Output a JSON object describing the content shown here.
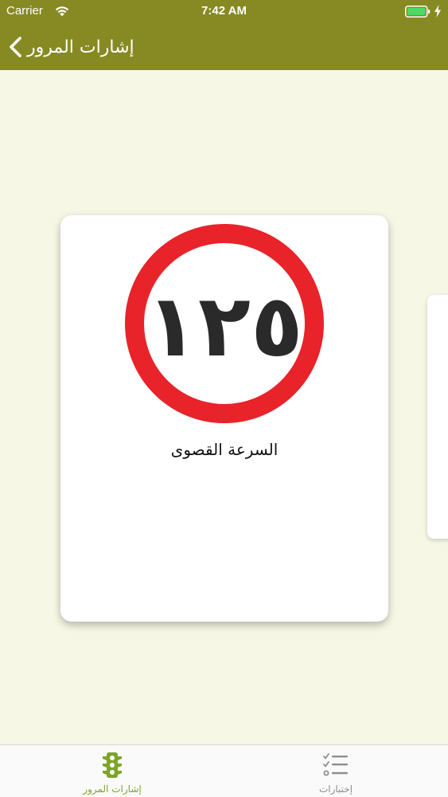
{
  "status_bar": {
    "carrier": "Carrier",
    "time": "7:42 AM"
  },
  "nav": {
    "title": "إشارات المرور",
    "back_icon": "chevron-left-icon"
  },
  "card": {
    "sign_number": "١٢٥",
    "caption": "السرعة القصوى"
  },
  "tabs": [
    {
      "label": "إشارات المرور",
      "icon": "traffic-light-icon",
      "selected": true
    },
    {
      "label": "إختبارات",
      "icon": "list-check-icon",
      "selected": false
    }
  ],
  "colors": {
    "bar": "#878a22",
    "background": "#f7f7e6",
    "sign_ring": "#e8232a",
    "active_tab": "#7ea52b",
    "inactive_tab": "#8e8e8e"
  }
}
